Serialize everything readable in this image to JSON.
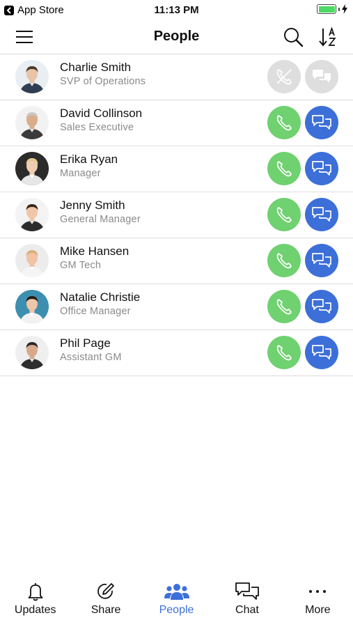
{
  "status_bar": {
    "back_app": "App Store",
    "time": "11:13 PM",
    "battery_level": 1.0
  },
  "header": {
    "title": "People",
    "menu_icon": "hamburger-menu-icon",
    "search_icon": "search-icon",
    "sort_icon": "sort-az-icon"
  },
  "colors": {
    "call_green": "#6fd16f",
    "chat_blue": "#3d6fd9",
    "disabled_gray": "#dedede",
    "subtitle_gray": "#8a8a8a",
    "active_tab": "#3d6fd9"
  },
  "people": [
    {
      "name": "Charlie Smith",
      "title": "SVP of Operations",
      "call_enabled": false,
      "chat_enabled": false,
      "avatar_bg": "#e8eef2",
      "skin": "#e9c4a6",
      "hair": "#4a3a2c",
      "shirt": "#2f3e52"
    },
    {
      "name": "David Collinson",
      "title": "Sales Executive",
      "call_enabled": true,
      "chat_enabled": true,
      "avatar_bg": "#f2f2f2",
      "skin": "#d9ad8c",
      "hair": "#c9c9c9",
      "shirt": "#3b3b3b"
    },
    {
      "name": "Erika Ryan",
      "title": "Manager",
      "call_enabled": true,
      "chat_enabled": true,
      "avatar_bg": "#2b2b2b",
      "skin": "#f0cdb0",
      "hair": "#e4c98e",
      "shirt": "#e6e6e6"
    },
    {
      "name": "Jenny Smith",
      "title": "General Manager",
      "call_enabled": true,
      "chat_enabled": true,
      "avatar_bg": "#f3f3f3",
      "skin": "#efc7a8",
      "hair": "#3c2517",
      "shirt": "#2b2b2b"
    },
    {
      "name": "Mike Hansen",
      "title": "GM Tech",
      "call_enabled": true,
      "chat_enabled": true,
      "avatar_bg": "#ececec",
      "skin": "#f0c3a3",
      "hair": "#d8b27a",
      "shirt": "#f5f5f5"
    },
    {
      "name": "Natalie Christie",
      "title": "Office Manager",
      "call_enabled": true,
      "chat_enabled": true,
      "avatar_bg": "#3d8fb0",
      "skin": "#eec6a8",
      "hair": "#2a1a12",
      "shirt": "#f2f2f2"
    },
    {
      "name": "Phil Page",
      "title": "Assistant GM",
      "call_enabled": true,
      "chat_enabled": true,
      "avatar_bg": "#efefef",
      "skin": "#d8a98a",
      "hair": "#2a2a2a",
      "shirt": "#2d2d2d"
    }
  ],
  "tabs": [
    {
      "label": "Updates",
      "icon": "bell-icon",
      "active": false
    },
    {
      "label": "Share",
      "icon": "compose-icon",
      "active": false
    },
    {
      "label": "People",
      "icon": "people-icon",
      "active": true
    },
    {
      "label": "Chat",
      "icon": "chat-bubbles-icon",
      "active": false
    },
    {
      "label": "More",
      "icon": "ellipsis-icon",
      "active": false
    }
  ]
}
